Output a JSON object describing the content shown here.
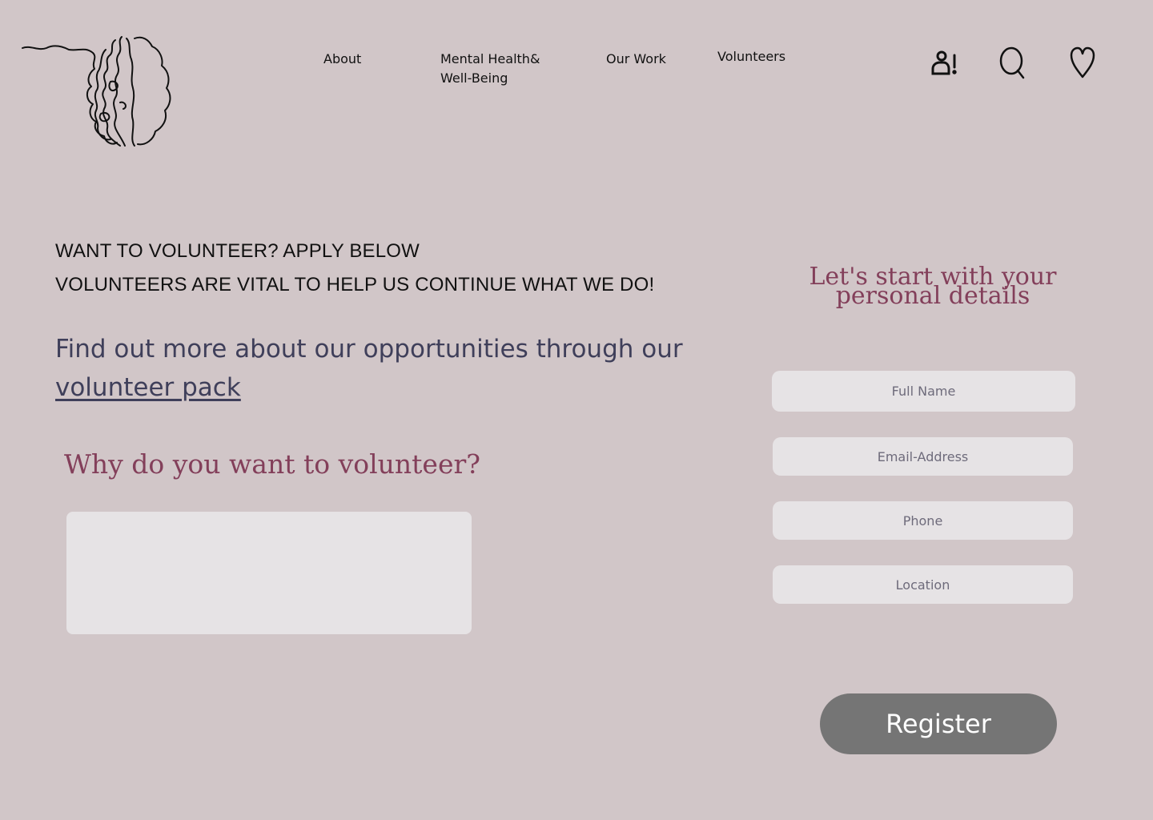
{
  "brand": {
    "logo_icon": "brain-line-art-icon"
  },
  "nav": {
    "about": "About",
    "mental_health": "Mental Health& Well-Being",
    "our_work": "Our Work",
    "volunteers": "Volunteers"
  },
  "header_icons": [
    "user-alert-icon",
    "search-icon",
    "heart-icon"
  ],
  "intro": {
    "line1": "WANT TO VOLUNTEER? APPLY BELOW",
    "line2": "VOLUNTEERS ARE VITAL TO HELP US CONTINUE WHAT WE DO!"
  },
  "find_out": {
    "text": "Find out more about our opportunities through our",
    "link": " volunteer pack"
  },
  "why": {
    "heading": "Why do you want to volunteer?",
    "value": ""
  },
  "form": {
    "title": "Let's start with your personal details",
    "full_name_placeholder": "Full Name",
    "email_placeholder": "Email-Address",
    "phone_placeholder": "Phone",
    "location_placeholder": "Location",
    "register_label": "Register"
  },
  "colors": {
    "background": "#d1c6c8",
    "accent": "#833f5a",
    "body_text": "#3f3f5a",
    "field": "#e6e3e5",
    "button": "#757575"
  }
}
